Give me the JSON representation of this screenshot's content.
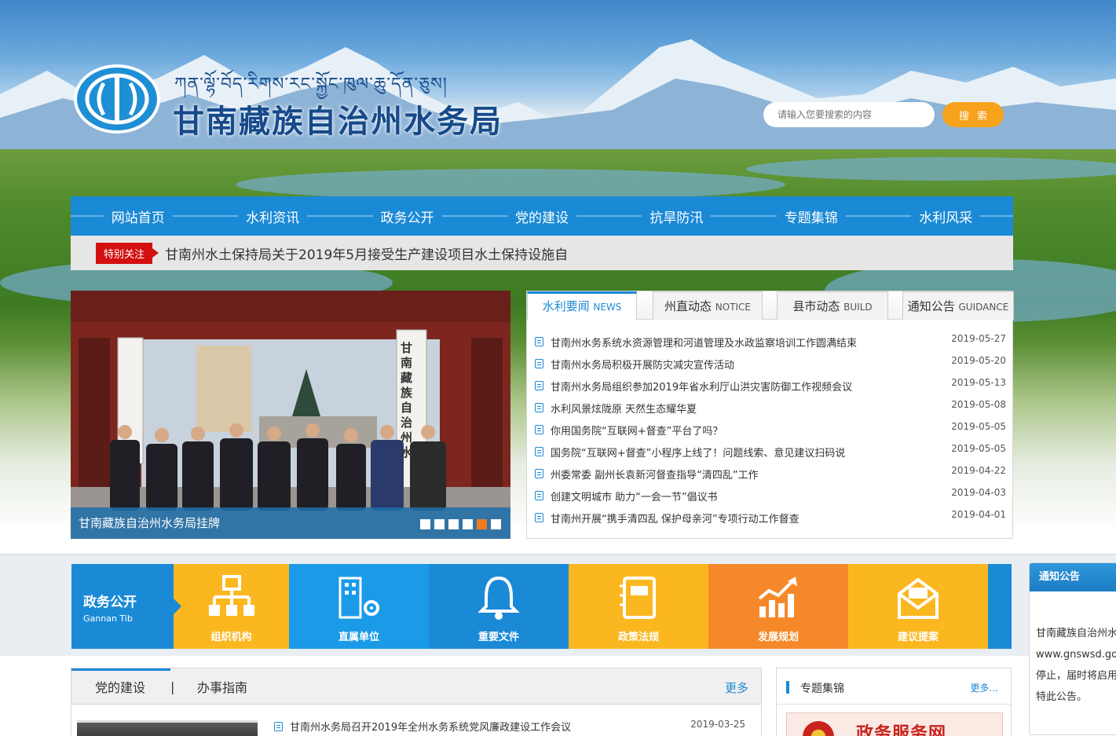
{
  "header": {
    "tibetan_title": "ཀན་ལྷོ་བོད་རིགས་རང་སྐྱོང་ཁུལ་ཆུ་དོན་ཅུས།",
    "title": "甘南藏族自治州水务局",
    "search": {
      "placeholder": "请输入您要搜索的内容",
      "button": "搜索"
    }
  },
  "nav": [
    "网站首页",
    "水利资讯",
    "政务公开",
    "党的建设",
    "抗旱防汛",
    "专题集锦",
    "水利风采"
  ],
  "notice_bar": {
    "tag": "特别关注",
    "text": "甘南州水土保持局关于2019年5月接受生产建设项目水土保持设施自"
  },
  "slider": {
    "caption": "甘南藏族自治州水务局挂牌",
    "active_index": 4,
    "dot_count": 6,
    "sign_text": "甘南藏族自治州水"
  },
  "news_tabs": [
    {
      "label": "水利要闻",
      "en": "NEWS"
    },
    {
      "label": "州直动态",
      "en": "NOTICE"
    },
    {
      "label": "县市动态",
      "en": "BUILD"
    },
    {
      "label": "通知公告",
      "en": "GUIDANCE"
    }
  ],
  "news": [
    {
      "title": "甘南州水务系统水资源管理和河道管理及水政监察培训工作圆满结束",
      "date": "2019-05-27"
    },
    {
      "title": "甘南州水务局积极开展防灾减灾宣传活动",
      "date": "2019-05-20"
    },
    {
      "title": "甘南州水务局组织参加2019年省水利厅山洪灾害防御工作视频会议",
      "date": "2019-05-13"
    },
    {
      "title": "水利风景炫陇原 天然生态耀华夏",
      "date": "2019-05-08"
    },
    {
      "title": "你用国务院“互联网+督查”平台了吗？",
      "date": "2019-05-05"
    },
    {
      "title": "国务院“互联网+督查”小程序上线了！问题线索、意见建议扫码说",
      "date": "2019-05-05"
    },
    {
      "title": "州委常委 副州长袁新河督查指导“清四乱”工作",
      "date": "2019-04-22"
    },
    {
      "title": "创建文明城市 助力“一会一节”倡议书",
      "date": "2019-04-03"
    },
    {
      "title": "甘南州开展“携手清四乱 保护母亲河”专项行动工作督查",
      "date": "2019-04-01"
    }
  ],
  "services": {
    "title": "政务公开",
    "subtitle": "Gannan Tib",
    "items": [
      {
        "label": "组织机构",
        "icon": "org-chart-icon",
        "color": "#fbb720"
      },
      {
        "label": "直属单位",
        "icon": "building-gear-icon",
        "color": "#1b9ae8"
      },
      {
        "label": "重要文件",
        "icon": "bell-icon",
        "color": "#1b8ad6"
      },
      {
        "label": "政策法规",
        "icon": "notebook-icon",
        "color": "#fbb720"
      },
      {
        "label": "发展规划",
        "icon": "growth-chart-icon",
        "color": "#f5892a"
      },
      {
        "label": "建议提案",
        "icon": "envelope-icon",
        "color": "#fbb720"
      }
    ]
  },
  "side_notice": {
    "title": "通知公告",
    "lines": [
      "甘南藏族自治州水",
      "www.gnswsd.go",
      "停止，届时将启用",
      "特此公告。"
    ]
  },
  "party": {
    "tabs": [
      "党的建设",
      "办事指南"
    ],
    "separator": "|",
    "more": "更多",
    "news": [
      {
        "title": "甘南州水务局召开2019年全州水务系统党风廉政建设工作会议",
        "date": "2019-03-25"
      }
    ]
  },
  "topic": {
    "title": "专题集锦",
    "more": "更多...",
    "banner_text": "政务服务网"
  }
}
